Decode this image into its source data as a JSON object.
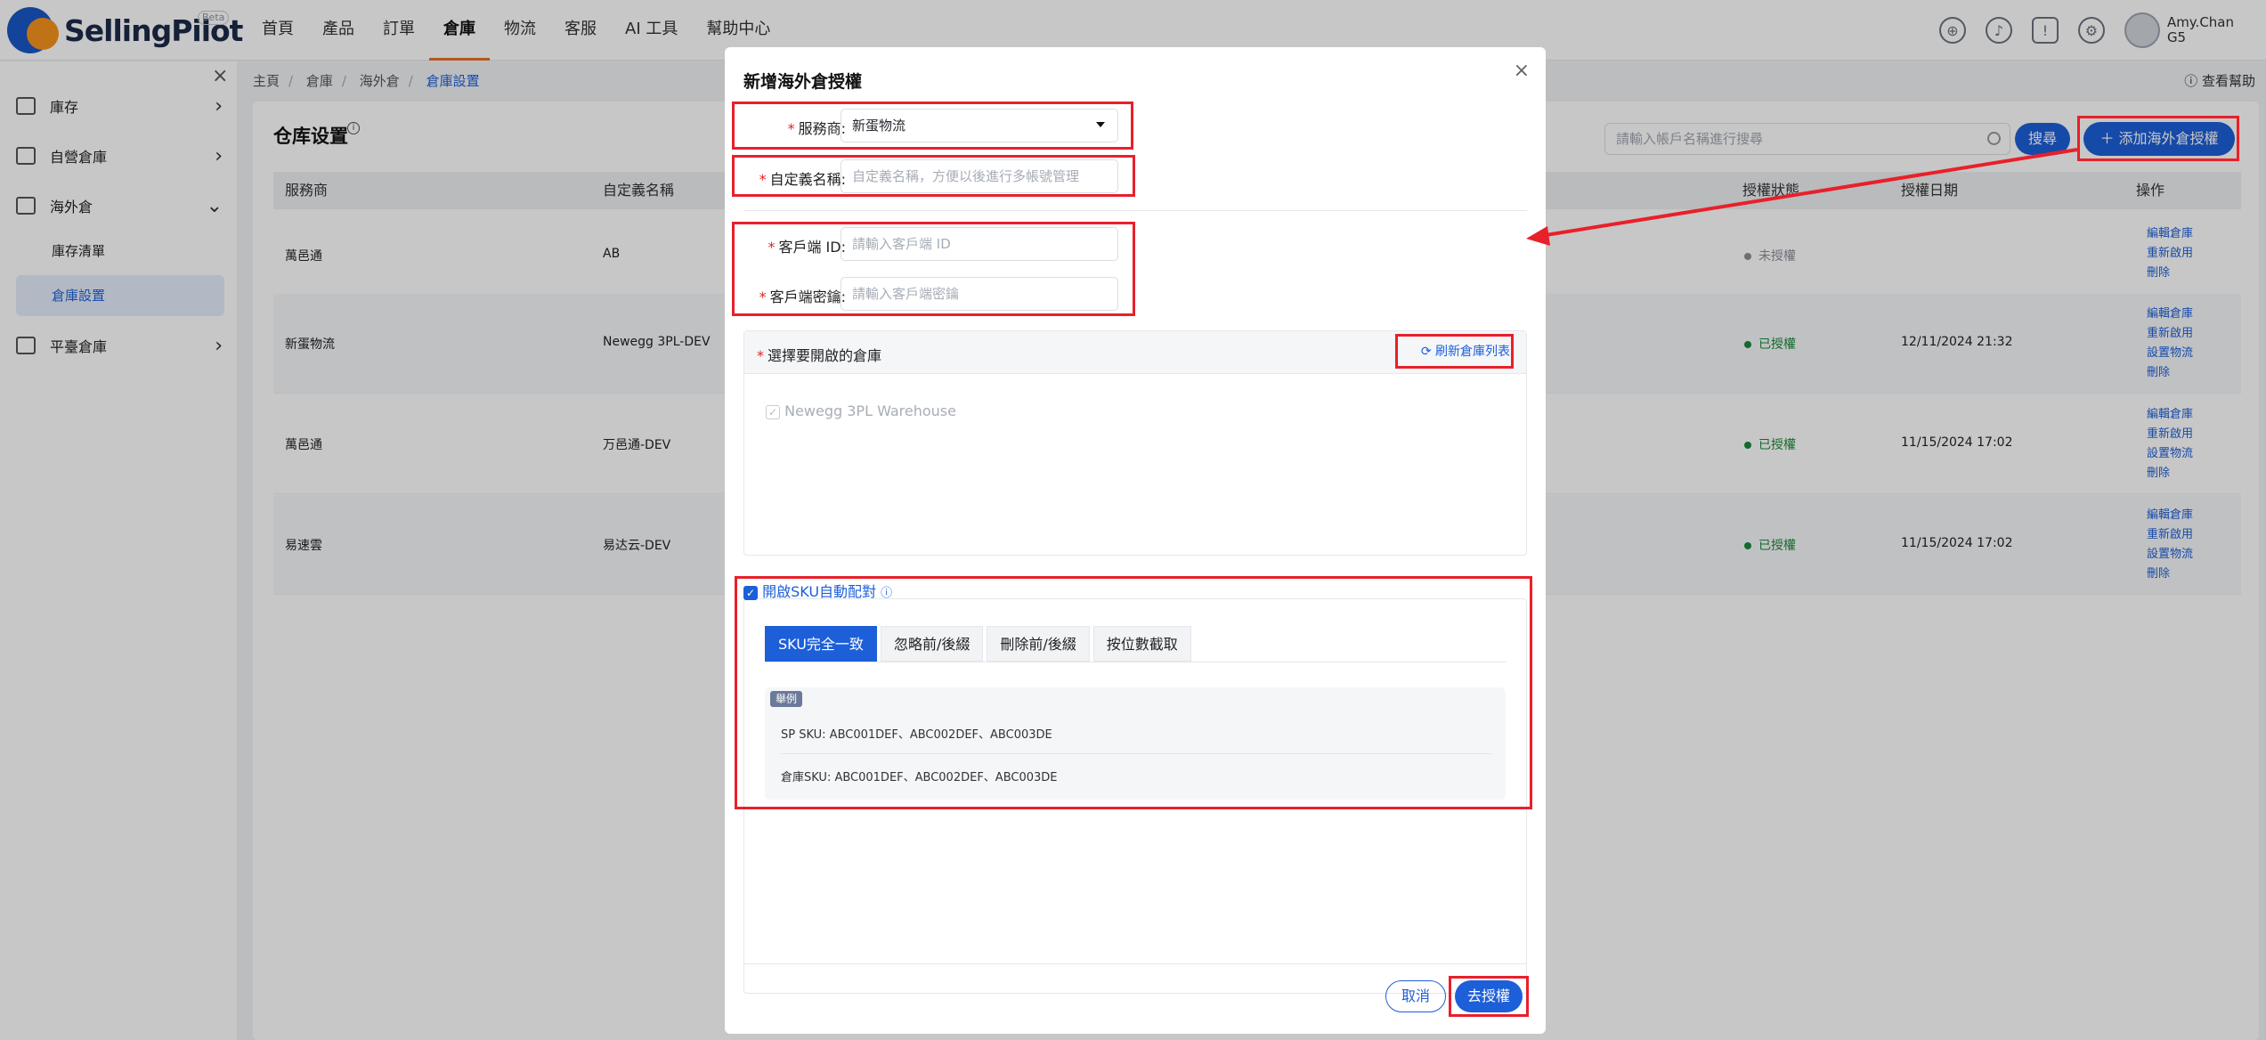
{
  "app": {
    "logo_text": "SellingPilot",
    "beta": "Beta",
    "nav": [
      "首頁",
      "產品",
      "訂單",
      "倉庫",
      "物流",
      "客服",
      "AI 工具",
      "幫助中心"
    ],
    "user_name": "Amy.Chan",
    "user_sub": "G5"
  },
  "sidebar": {
    "items": [
      {
        "label": "庫存"
      },
      {
        "label": "自營倉庫"
      },
      {
        "label": "海外倉"
      },
      {
        "label": "平臺倉庫"
      }
    ],
    "subitems": [
      "庫存清單",
      "倉庫設置"
    ]
  },
  "breadcrumb": [
    "主頁",
    "倉庫",
    "海外倉",
    "倉庫設置"
  ],
  "help_label": "查看幫助",
  "page": {
    "title": "仓库设置",
    "search_placeholder": "請輸入帳戶名稱進行搜尋",
    "search_button": "搜尋",
    "add_button": "添加海外倉授權"
  },
  "table": {
    "columns": [
      "服務商",
      "自定義名稱",
      "授權狀態",
      "授權日期",
      "操作"
    ],
    "rows": [
      {
        "provider": "萬邑通",
        "name": "AB",
        "status": "未授權",
        "date": "",
        "ops": [
          "編輯倉庫",
          "重新啟用",
          "刪除"
        ]
      },
      {
        "provider": "新蛋物流",
        "name": "Newegg 3PL-DEV",
        "status": "已授權",
        "date": "12/11/2024 21:32",
        "ops": [
          "編輯倉庫",
          "重新啟用",
          "設置物流",
          "刪除"
        ]
      },
      {
        "provider": "萬邑通",
        "name": "万邑通-DEV",
        "status": "已授權",
        "date": "11/15/2024 17:02",
        "ops": [
          "編輯倉庫",
          "重新啟用",
          "設置物流",
          "刪除"
        ]
      },
      {
        "provider": "易速雲",
        "name": "易达云-DEV",
        "status": "已授權",
        "date": "11/15/2024 17:02",
        "ops": [
          "編輯倉庫",
          "重新啟用",
          "設置物流",
          "刪除"
        ]
      }
    ]
  },
  "modal": {
    "title": "新增海外倉授權",
    "provider_label": "服務商:",
    "provider_value": "新蛋物流",
    "alias_label": "自定義名稱:",
    "alias_placeholder": "自定義名稱，方便以後進行多帳號管理",
    "client_id_label": "客戶端 ID:",
    "client_id_placeholder": "請輸入客戶端 ID",
    "client_secret_label": "客戶端密鑰:",
    "client_secret_placeholder": "請輸入客戶端密鑰",
    "warehouse_label": "選擇要開啟的倉庫",
    "refresh_label": "刷新倉庫列表",
    "warehouse_item": "Newegg 3PL Warehouse",
    "sku_label": "開啟SKU自動配對",
    "tabs": [
      "SKU完全一致",
      "忽略前/後綴",
      "刪除前/後綴",
      "按位數截取"
    ],
    "example_tag": "舉例",
    "example_sp": "SP SKU: ABC001DEF、ABC002DEF、ABC003DE",
    "example_wh": "倉庫SKU: ABC001DEF、ABC002DEF、ABC003DE",
    "cancel": "取消",
    "authorize": "去授權"
  },
  "colors": {
    "primary": "#1d5fd8",
    "accent": "#e8702a",
    "annotation": "#e8202a",
    "success": "#1a8a3a"
  }
}
